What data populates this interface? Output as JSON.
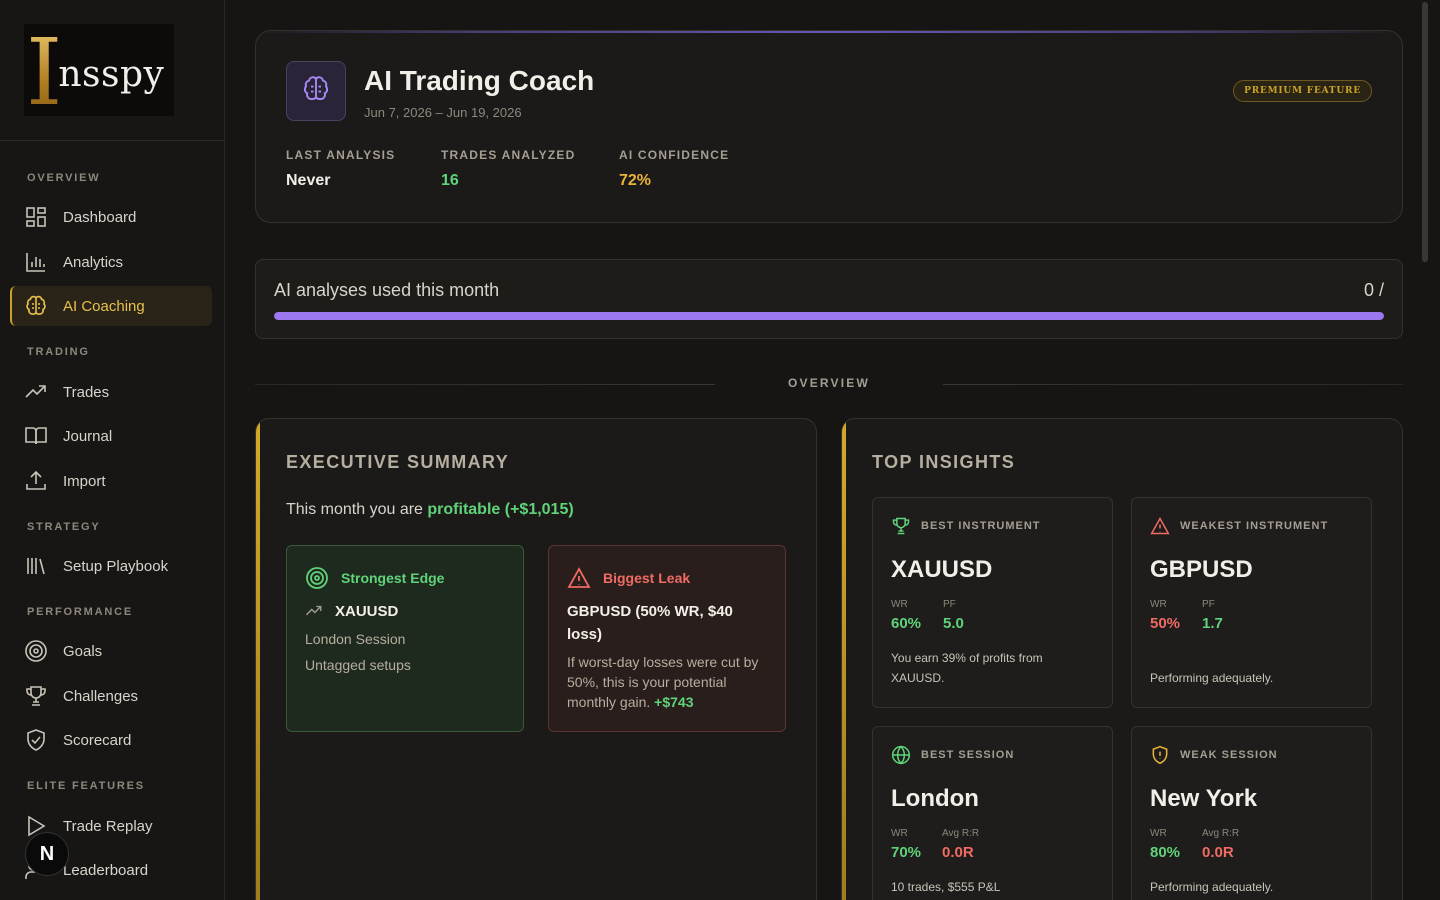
{
  "logo": {
    "letter": "I",
    "rest": "nsspy"
  },
  "sidebar": {
    "sections": {
      "overview": "OVERVIEW",
      "trading": "TRADING",
      "strategy": "STRATEGY",
      "performance": "PERFORMANCE",
      "elite": "ELITE FEATURES"
    },
    "items": {
      "dashboard": "Dashboard",
      "analytics": "Analytics",
      "ai_coaching": "AI Coaching",
      "trades": "Trades",
      "journal": "Journal",
      "import": "Import",
      "setup_playbook": "Setup Playbook",
      "goals": "Goals",
      "challenges": "Challenges",
      "scorecard": "Scorecard",
      "trade_replay": "Trade Replay",
      "leaderboard": "Leaderboard"
    },
    "active": "ai_coaching",
    "badge": "N"
  },
  "header": {
    "title": "AI Trading Coach",
    "date_range": "Jun 7, 2026 – Jun 19, 2026",
    "premium_badge": "PREMIUM FEATURE",
    "stats": [
      {
        "label": "LAST ANALYSIS",
        "value": "Never"
      },
      {
        "label": "TRADES ANALYZED",
        "value": "16"
      },
      {
        "label": "AI CONFIDENCE",
        "value": "72%"
      }
    ]
  },
  "usage": {
    "label": "AI analyses used this month",
    "count": "0 /",
    "fill_fraction": 1.0
  },
  "divider": "OVERVIEW",
  "executive_summary": {
    "title": "EXECUTIVE SUMMARY",
    "line_prefix": "This month you are",
    "line_highlight": "profitable (+$1,015)",
    "edge": {
      "title": "Strongest Edge",
      "instrument": "XAUUSD",
      "session": "London Session",
      "setups": "Untagged setups"
    },
    "leak": {
      "title": "Biggest Leak",
      "headline": "GBPUSD (50% WR, $40 loss)",
      "body": "If worst-day losses were cut by 50%, this is your potential monthly gain.",
      "gain": "+$743"
    }
  },
  "top_insights": {
    "title": "TOP INSIGHTS",
    "cards": [
      {
        "label": "BEST INSTRUMENT",
        "name": "XAUUSD",
        "k1": "WR",
        "v1": "60%",
        "k2": "PF",
        "v2": "5.0",
        "note": "You earn 39% of profits from XAUUSD."
      },
      {
        "label": "WEAKEST INSTRUMENT",
        "name": "GBPUSD",
        "k1": "WR",
        "v1": "50%",
        "k2": "PF",
        "v2": "1.7",
        "note": "Performing adequately."
      },
      {
        "label": "BEST SESSION",
        "name": "London",
        "k1": "WR",
        "v1": "70%",
        "k2": "Avg R:R",
        "v2": "0.0R",
        "note": "10 trades, $555 P&L"
      },
      {
        "label": "WEAK SESSION",
        "name": "New York",
        "k1": "WR",
        "v1": "80%",
        "k2": "Avg R:R",
        "v2": "0.0R",
        "note": "Performing adequately."
      }
    ]
  },
  "colors": {
    "accent_gold": "#c9a227",
    "accent_purple": "#9b77f0",
    "positive": "#5fd37a",
    "negative": "#ef6b63"
  }
}
